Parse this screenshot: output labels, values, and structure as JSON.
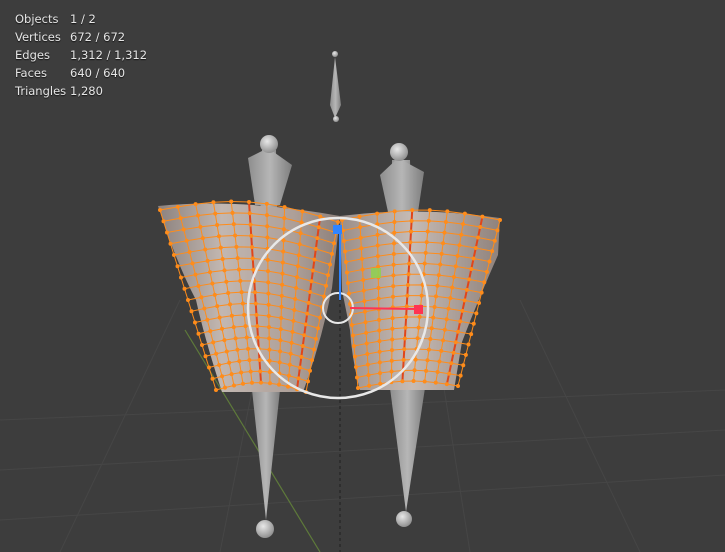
{
  "stats": {
    "objects": {
      "label": "Objects",
      "value": "1 / 2"
    },
    "vertices": {
      "label": "Vertices",
      "value": "672 / 672"
    },
    "edges": {
      "label": "Edges",
      "value": "1,312 / 1,312"
    },
    "faces": {
      "label": "Faces",
      "value": "640 / 640"
    },
    "triangles": {
      "label": "Triangles",
      "value": "1,280"
    }
  },
  "colors": {
    "background": "#3d3d3d",
    "grid_line": "#4a4a4a",
    "vertex_selected": "#ff8c1a",
    "seam_edge": "#e0451a",
    "mesh_surface": "#b8aca6",
    "gizmo_x": "#ff3352",
    "gizmo_z": "#2f84ff",
    "gizmo_center": "#ffffff"
  }
}
